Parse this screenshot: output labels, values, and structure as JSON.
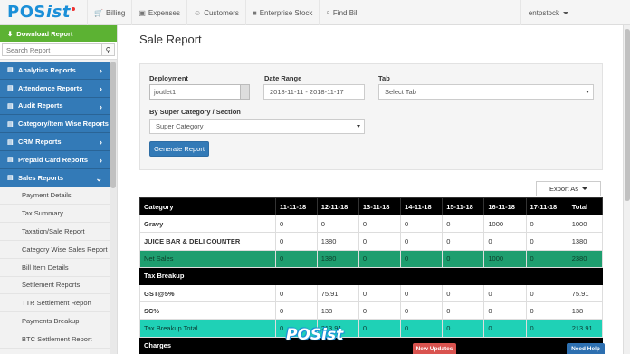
{
  "brand": {
    "name": "POS",
    "suffix": "ist"
  },
  "nav": {
    "items": [
      {
        "icon": "shopping-cart-icon",
        "label": "Billing"
      },
      {
        "icon": "money-icon",
        "label": "Expenses"
      },
      {
        "icon": "users-icon",
        "label": "Customers"
      },
      {
        "icon": "truck-icon",
        "label": "Enterprise Stock"
      },
      {
        "icon": "search-icon",
        "label": "Find Bill"
      }
    ],
    "user": "entpstock"
  },
  "sidebar": {
    "download_label": "Download Report",
    "search_placeholder": "Search Report",
    "menu": [
      {
        "label": "Analytics Reports"
      },
      {
        "label": "Attendence Reports"
      },
      {
        "label": "Audit Reports"
      },
      {
        "label": "Category/Item Wise Reports"
      },
      {
        "label": "CRM Reports"
      },
      {
        "label": "Prepaid Card Reports"
      },
      {
        "label": "Sales Reports"
      }
    ],
    "sales_sub": [
      "Payment Details",
      "Tax Summary",
      "Taxation/Sale Report",
      "Category Wise Sales Report",
      "Bill Item Details",
      "Settlement Reports",
      "TTR Settlement Report",
      "Payments Breakup",
      "BTC Settlement Report"
    ]
  },
  "main": {
    "title": "Sale Report",
    "filters": {
      "deployment_label": "Deployment",
      "deployment_value": "joutlet1",
      "date_range_label": "Date Range",
      "date_range_value": "2018-11-11 - 2018-11-17",
      "tab_label": "Tab",
      "tab_value": "Select Tab",
      "category_label": "By Super Category / Section",
      "category_value": "Super Category",
      "generate_label": "Generate Report"
    },
    "export_label": "Export As",
    "table": {
      "headers": [
        "Category",
        "11-11-18",
        "12-11-18",
        "13-11-18",
        "14-11-18",
        "15-11-18",
        "16-11-18",
        "17-11-18",
        "Total"
      ],
      "rows": [
        {
          "type": "normal",
          "cells": [
            "Gravy",
            "0",
            "0",
            "0",
            "0",
            "0",
            "1000",
            "0",
            "1000"
          ]
        },
        {
          "type": "normal",
          "cells": [
            "JUICE BAR & DELI COUNTER",
            "0",
            "1380",
            "0",
            "0",
            "0",
            "0",
            "0",
            "1380"
          ]
        },
        {
          "type": "netsales",
          "cells": [
            "Net Sales",
            "0",
            "1380",
            "0",
            "0",
            "0",
            "1000",
            "0",
            "2380"
          ]
        },
        {
          "type": "section",
          "cells": [
            "Tax Breakup"
          ]
        },
        {
          "type": "normal",
          "cells": [
            "GST@5%",
            "0",
            "75.91",
            "0",
            "0",
            "0",
            "0",
            "0",
            "75.91"
          ]
        },
        {
          "type": "normal",
          "cells": [
            "SC%",
            "0",
            "138",
            "0",
            "0",
            "0",
            "0",
            "0",
            "138"
          ]
        },
        {
          "type": "taxtotal",
          "cells": [
            "Tax Breakup Total",
            "0",
            "213.91",
            "0",
            "0",
            "0",
            "0",
            "0",
            "213.91"
          ]
        },
        {
          "type": "section",
          "cells": [
            "Charges"
          ]
        }
      ]
    }
  },
  "footer": {
    "new_updates": "New Updates",
    "need_help": "Need Help",
    "brand_float": "POSist"
  },
  "colors": {
    "accent": "#337ab7",
    "download_green": "#5cb233",
    "net_sales": "#1e9e6f",
    "tax_total": "#1fd1b6"
  }
}
